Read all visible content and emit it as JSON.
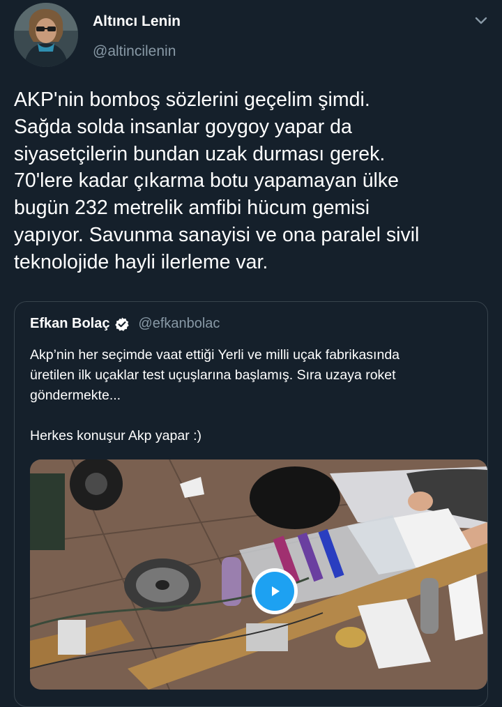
{
  "author": {
    "name": "Altıncı Lenin",
    "handle": "@altincilenin"
  },
  "tweet": {
    "lines": [
      "AKP'nin bomboş sözlerini geçelim şimdi.",
      "Sağda solda insanlar goygoy yapar da",
      "siyasetçilerin bundan uzak durması gerek.",
      "70'lere kadar çıkarma botu yapamayan ülke",
      "bugün 232 metrelik amfibi hücum gemisi",
      "yapıyor. Savunma sanayisi ve ona paralel sivil",
      "teknolojide hayli ilerleme var."
    ]
  },
  "quoted_tweet": {
    "name": "Efkan Bolaç",
    "handle": "@efkanbolac",
    "lines": [
      "Akp’nin her seçimde vaat ettiği Yerli ve milli uçak fabrikasında",
      "üretilen ilk uçaklar test uçuşlarına başlamış. Sıra uzaya roket",
      "göndermekte..."
    ],
    "second_paragraph": "Herkes konuşur Akp yapar :)"
  },
  "icons": {
    "menu": "chevron-down-icon",
    "verified": "verified-badge-icon",
    "play": "play-icon"
  },
  "colors": {
    "background": "#15202b",
    "secondary_text": "#8899a6",
    "border": "#38444d",
    "accent": "#1da1f2"
  }
}
